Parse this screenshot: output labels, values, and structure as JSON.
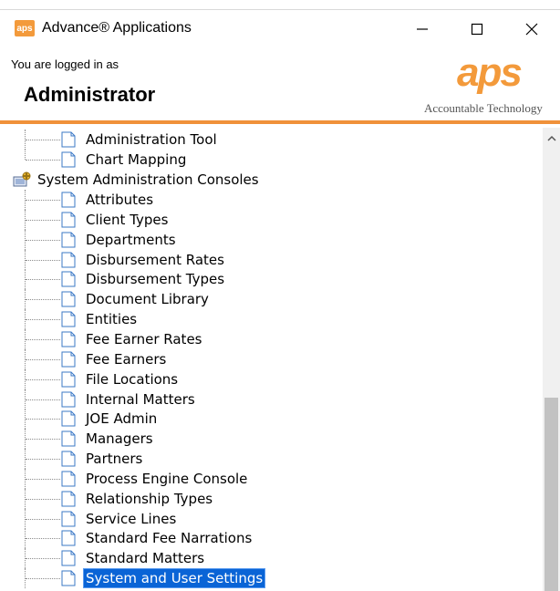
{
  "window": {
    "app_icon_text": "aps",
    "title": "Advance® Applications",
    "minimize_glyph": "—",
    "maximize_glyph": "☐",
    "close_glyph": "✕"
  },
  "header": {
    "logged_in_label": "You are logged in as",
    "user_name": "Administrator",
    "logo_mark": "aps",
    "logo_tagline": "Accountable Technology"
  },
  "tree": {
    "items_before": [
      {
        "label": "Administration Tool",
        "icon": "document-icon"
      },
      {
        "label": "Chart Mapping",
        "icon": "document-icon"
      }
    ],
    "group": {
      "label": "System Administration Consoles",
      "icon": "console-folder-icon"
    },
    "items": [
      {
        "label": "Attributes"
      },
      {
        "label": "Client Types"
      },
      {
        "label": "Departments"
      },
      {
        "label": "Disbursement Rates"
      },
      {
        "label": "Disbursement Types"
      },
      {
        "label": "Document Library"
      },
      {
        "label": "Entities"
      },
      {
        "label": "Fee Earner Rates"
      },
      {
        "label": "Fee Earners"
      },
      {
        "label": "File Locations"
      },
      {
        "label": "Internal Matters"
      },
      {
        "label": "JOE Admin"
      },
      {
        "label": "Managers"
      },
      {
        "label": "Partners"
      },
      {
        "label": "Process Engine Console"
      },
      {
        "label": "Relationship Types"
      },
      {
        "label": "Service Lines"
      },
      {
        "label": "Standard Fee Narrations"
      },
      {
        "label": "Standard Matters"
      },
      {
        "label": "System and User Settings",
        "selected": true
      }
    ]
  },
  "colors": {
    "accent_orange": "#f0913a",
    "selection_blue": "#0a64d6"
  }
}
